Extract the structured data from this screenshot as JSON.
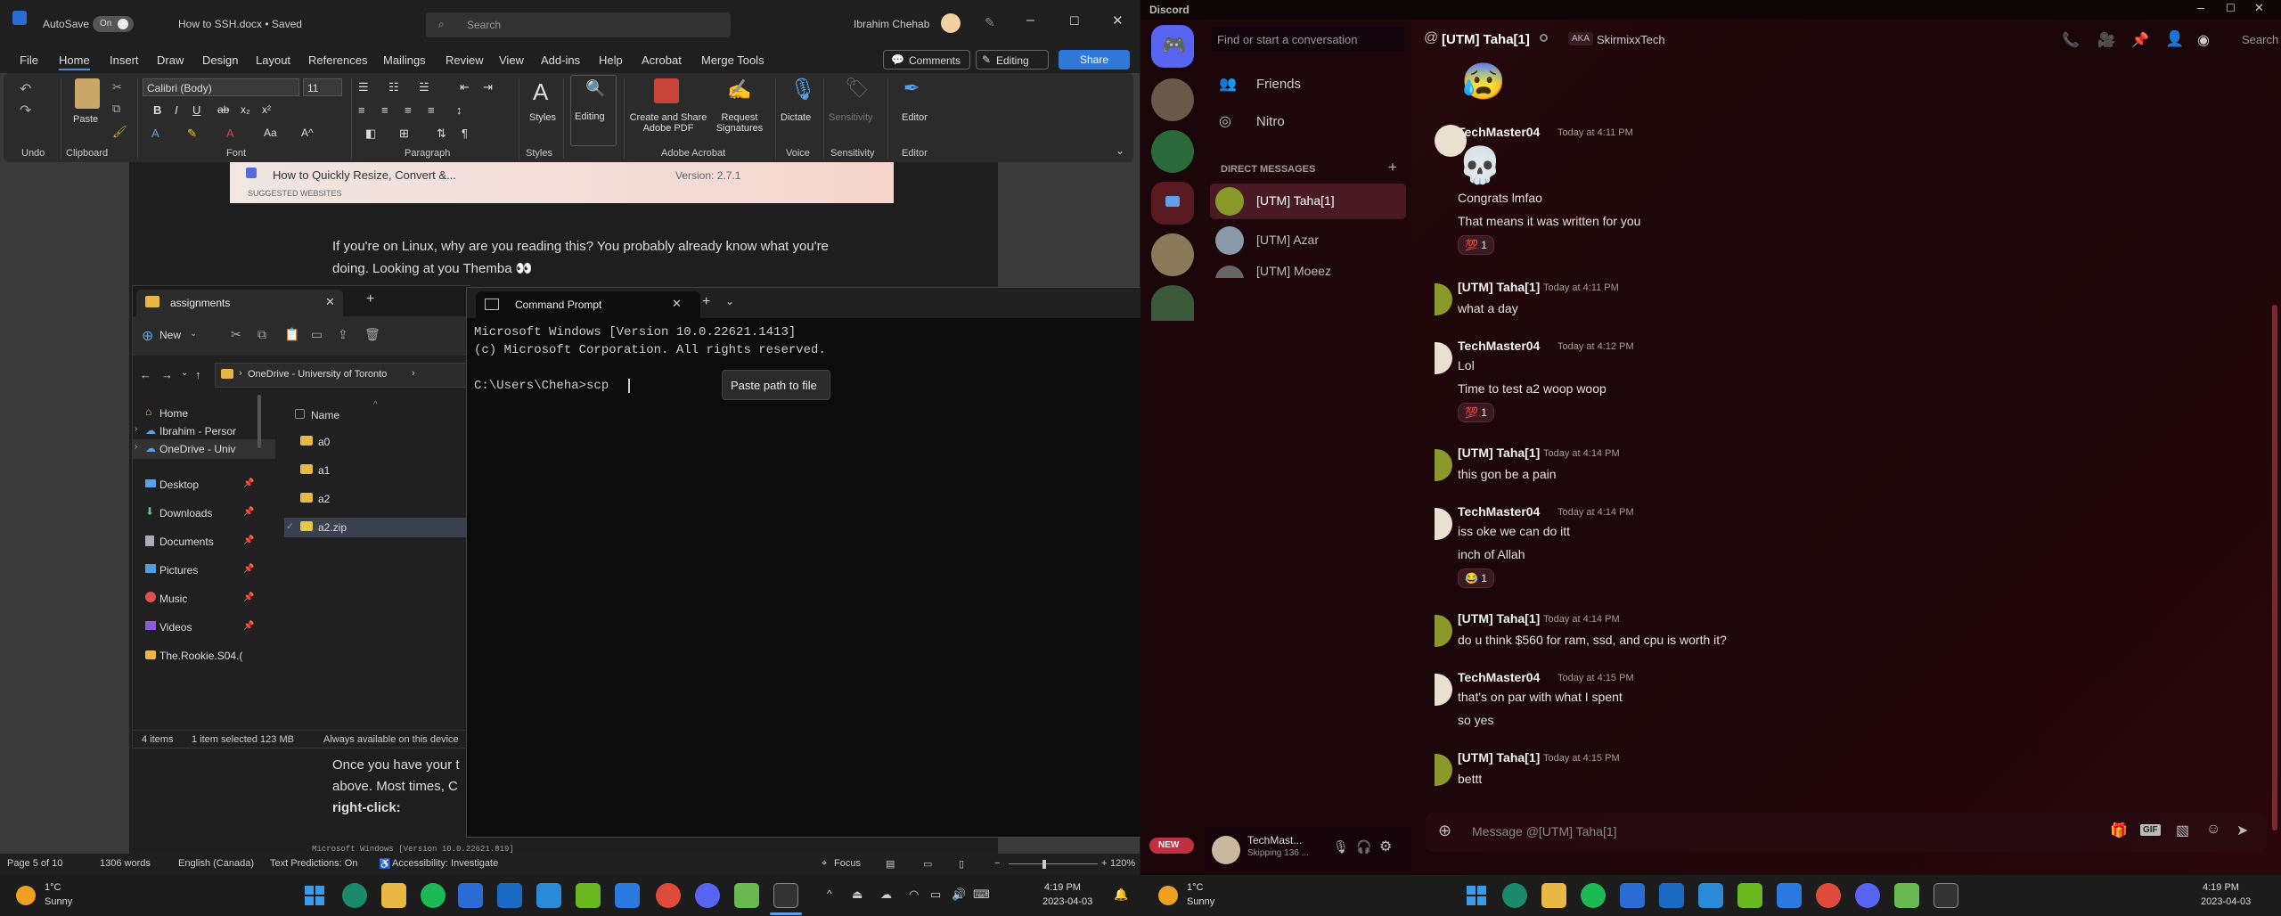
{
  "word": {
    "autosave_label": "AutoSave",
    "autosave_state": "On",
    "doc_title": "How to SSH.docx • Saved",
    "search_placeholder": "Search",
    "user_name": "Ibrahim Chehab",
    "tabs": [
      "File",
      "Home",
      "Insert",
      "Draw",
      "Design",
      "Layout",
      "References",
      "Mailings",
      "Review",
      "View",
      "Add-ins",
      "Help",
      "Acrobat",
      "Merge Tools"
    ],
    "comments_label": "Comments",
    "editing_label": "Editing",
    "share_label": "Share",
    "ribbon": {
      "undo_group": "Undo",
      "clipboard_group": "Clipboard",
      "paste_label": "Paste",
      "font_name": "Calibri (Body)",
      "font_size": "11",
      "font_group": "Font",
      "paragraph_group": "Paragraph",
      "styles_label": "Styles",
      "styles_group": "Styles",
      "editing_btn": "Editing",
      "create_share_label": "Create and Share Adobe PDF",
      "request_sig_label": "Request Signatures",
      "adobe_group": "Adobe Acrobat",
      "dictate_label": "Dictate",
      "voice_group": "Voice",
      "sensitivity_label": "Sensitivity",
      "sensitivity_group": "Sensitivity",
      "editor_label": "Editor",
      "editor_group": "Editor"
    },
    "doc": {
      "embedded_title": "How to Quickly Resize, Convert &...",
      "embedded_sub": "SUGGESTED WEBSITES",
      "embedded_version": "Version: 2.7.1",
      "para1_line1": "If you're on Linux, why are you reading this? You probably already know what you're",
      "para1_line2": "doing. Looking at you Themba 👀",
      "para2_line1": "Once you have your t",
      "para2_line2": "above. Most times, C",
      "para2_line3": "right-click:",
      "snippet": "Microsoft Windows [Version 10.0.22621.819]"
    },
    "status": {
      "page": "Page 5 of 10",
      "words": "1306 words",
      "language": "English (Canada)",
      "text_predictions": "Text Predictions: On",
      "accessibility": "Accessibility: Investigate",
      "focus": "Focus",
      "zoom": "120%"
    }
  },
  "explorer": {
    "tab_title": "assignments",
    "new_label": "New",
    "breadcrumb": "OneDrive - University of Toronto",
    "column_name": "Name",
    "sidebar": [
      "Home",
      "Ibrahim - Persor",
      "OneDrive - Univ",
      "Desktop",
      "Downloads",
      "Documents",
      "Pictures",
      "Music",
      "Videos",
      "The.Rookie.S04.("
    ],
    "files": [
      "a0",
      "a1",
      "a2",
      "a2.zip"
    ],
    "status_items": "4 items",
    "status_selected": "1 item selected  123 MB",
    "status_avail": "Always available on this device"
  },
  "cmd": {
    "tab_title": "Command Prompt",
    "lines": [
      "Microsoft Windows [Version 10.0.22621.1413]",
      "(c) Microsoft Corporation. All rights reserved.",
      "",
      "C:\\Users\\Cheha>scp "
    ],
    "tooltip": "Paste path to file"
  },
  "discord": {
    "app_title": "Discord",
    "search_placeholder": "Find or start a conversation",
    "friends_label": "Friends",
    "nitro_label": "Nitro",
    "dm_header": "DIRECT MESSAGES",
    "dms": [
      "[UTM] Taha[1]",
      "[UTM] Azar",
      "[UTM] Moeez"
    ],
    "channel_title": "[UTM] Taha[1]",
    "aka_label": "AKA",
    "aka_name": "SkirmixxTech",
    "header_search": "Search",
    "top_emoji": "😰",
    "messages": [
      {
        "author": "TechMaster04",
        "time": "Today at 4:11 PM",
        "lines": [
          "💀",
          "Congrats lmfao",
          "That means it was written for you"
        ],
        "reaction": "💯 1"
      },
      {
        "author": "[UTM] Taha[1]",
        "time": "Today at 4:11 PM",
        "lines": [
          "what a day"
        ],
        "reaction": ""
      },
      {
        "author": "TechMaster04",
        "time": "Today at 4:12 PM",
        "lines": [
          "Lol",
          "Time to test a2 woop woop"
        ],
        "reaction": "💯 1"
      },
      {
        "author": "[UTM] Taha[1]",
        "time": "Today at 4:14 PM",
        "lines": [
          "this gon be a pain"
        ],
        "reaction": ""
      },
      {
        "author": "TechMaster04",
        "time": "Today at 4:14 PM",
        "lines": [
          "iss oke we can do itt",
          "inch of Allah"
        ],
        "reaction": "😂 1"
      },
      {
        "author": "[UTM] Taha[1]",
        "time": "Today at 4:14 PM",
        "lines": [
          "do u think $560 for ram, ssd, and cpu is worth it?"
        ],
        "reaction": ""
      },
      {
        "author": "TechMaster04",
        "time": "Today at 4:15 PM",
        "lines": [
          "that's on par with what I spent",
          "so yes"
        ],
        "reaction": ""
      },
      {
        "author": "[UTM] Taha[1]",
        "time": "Today at 4:15 PM",
        "lines": [
          "bettt"
        ],
        "reaction": ""
      }
    ],
    "message_placeholder": "Message @[UTM] Taha[1]",
    "user_panel_name": "TechMast...",
    "user_panel_status": "Skipping 136 ...",
    "new_badge": "NEW"
  },
  "taskbar_left": {
    "temp": "1°C",
    "weather": "Sunny",
    "time": "4:19 PM",
    "date": "2023-04-03"
  },
  "taskbar_right": {
    "temp": "1°C",
    "weather": "Sunny",
    "time": "4:19 PM",
    "date": "2023-04-03"
  }
}
